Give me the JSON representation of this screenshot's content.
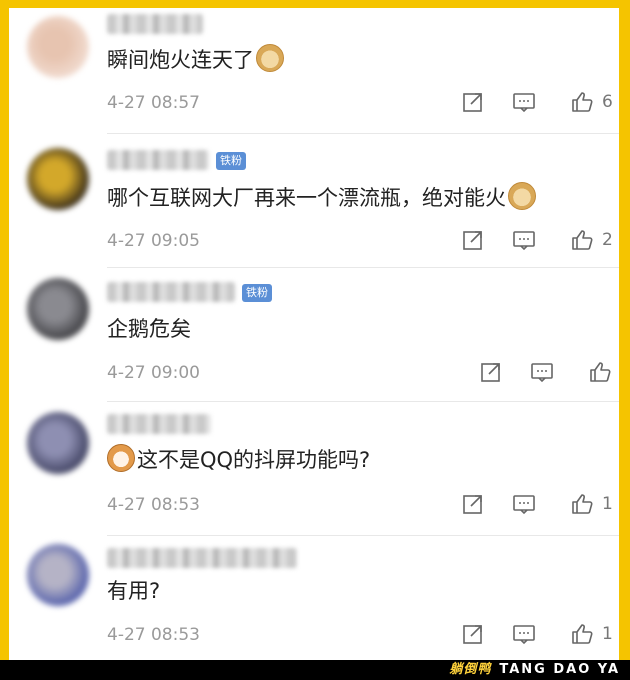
{
  "comments": [
    {
      "text": "瞬间炮火连天了",
      "emoji": "doge-emoji",
      "emoji_position": "after",
      "time": "4-27 08:57",
      "badge": "",
      "likes": "6",
      "avatar_colors": [
        "#f2ddd2",
        "#e7c4b0"
      ]
    },
    {
      "text": "哪个互联网大厂再来一个漂流瓶，绝对能火",
      "emoji": "doge-emoji",
      "emoji_position": "after",
      "time": "4-27 09:05",
      "badge": "铁粉",
      "likes": "2",
      "avatar_colors": [
        "#2a2118",
        "#d3a82a"
      ]
    },
    {
      "text": "企鹅危矣",
      "emoji": "",
      "emoji_position": "",
      "time": "4-27 09:00",
      "badge": "铁粉",
      "likes": "",
      "avatar_colors": [
        "#3a3a3e",
        "#8a8a90"
      ]
    },
    {
      "text": "这不是QQ的抖屏功能吗?",
      "emoji": "cat-emoji",
      "emoji_position": "before",
      "time": "4-27 08:53",
      "badge": "",
      "likes": "1",
      "avatar_colors": [
        "#3b3d5c",
        "#8e8fb2"
      ]
    },
    {
      "text": "有用?",
      "emoji": "",
      "emoji_position": "",
      "time": "4-27 08:53",
      "badge": "",
      "likes": "1",
      "avatar_colors": [
        "#4a57a8",
        "#b5b3c6"
      ]
    }
  ],
  "icons": {
    "share": "share-icon",
    "comment": "comment-icon",
    "like": "thumbs-up-icon"
  },
  "watermark": {
    "cn": "躺倒鸭",
    "latin": "TANG DAO YA"
  },
  "colors": {
    "frame": "#f5c400",
    "badge": "#5b8fd6",
    "time": "#9a9a9a"
  }
}
